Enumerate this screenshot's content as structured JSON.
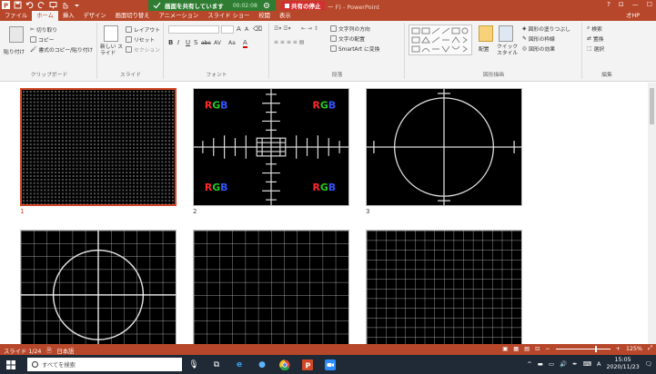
{
  "title_bar": {
    "share_banner_text": "画面を共有しています",
    "share_timer": "00:02:08",
    "stop_share_label": "共有の停止",
    "doc_title": "ー F) - PowerPoint",
    "window_controls": [
      "?",
      "⊡",
      "—",
      "☐"
    ]
  },
  "tabs": [
    "ファイル",
    "ホーム",
    "挿入",
    "デザイン",
    "画面切り替え",
    "アニメーション",
    "スライド ショー",
    "校閲",
    "表示"
  ],
  "active_tab": "ホーム",
  "user_label": "才HP",
  "ribbon": {
    "clipboard": {
      "paste": "貼り付け",
      "cut": "切り取り",
      "copy": "コピー",
      "format_painter": "書式のコピー/貼り付け",
      "label": "クリップボード"
    },
    "slides": {
      "new_slide": "新しい スライド",
      "layout": "レイアウト",
      "reset": "リセット",
      "section": "セクション",
      "label": "スライド"
    },
    "font": {
      "grow": "A",
      "shrink": "A",
      "change_case": "Aa",
      "format_buttons": [
        "B",
        "I",
        "U",
        "S",
        "abc",
        "AV"
      ],
      "label": "フォント"
    },
    "paragraph": {
      "text_direction": "文字列の方向",
      "align_text": "文字の配置",
      "smartart": "SmartArt に変換",
      "label": "段落"
    },
    "drawing": {
      "arrange": "配置",
      "quick_styles": "クイック スタイル",
      "shape_fill": "図形の塗りつぶし",
      "shape_outline": "図形の枠線",
      "shape_effects": "図形の効果",
      "label": "図形描画"
    },
    "editing": {
      "find": "検索",
      "replace": "置換",
      "select": "選択",
      "label": "編集"
    }
  },
  "slides": [
    {
      "number": "1",
      "pattern": "fine-dots",
      "selected": true
    },
    {
      "number": "2",
      "pattern": "rgb-crosshair",
      "selected": false,
      "labels": [
        "RGB",
        "RGB",
        "RGB",
        "RGB"
      ]
    },
    {
      "number": "3",
      "pattern": "circle-cross",
      "selected": false
    },
    {
      "number": "",
      "pattern": "circle-grid",
      "selected": false
    },
    {
      "number": "",
      "pattern": "grid",
      "selected": false
    },
    {
      "number": "",
      "pattern": "grid",
      "selected": false
    }
  ],
  "status_bar": {
    "slide_indicator": "スライド 1/24",
    "language": "日本語",
    "zoom": "125%",
    "zoom_level_fraction": 0.72
  },
  "taskbar": {
    "search_placeholder": "すべてを検索",
    "ime": "A",
    "time": "15:05",
    "date": "2020/11/23"
  },
  "colors": {
    "accent": "#b7472a",
    "share_banner": "#2f7d32",
    "stop_share": "#d32f2f",
    "selected_border": "#d24726",
    "rgb_r": "#ff2a2a",
    "rgb_g": "#22cc22",
    "rgb_b": "#3355ff"
  }
}
